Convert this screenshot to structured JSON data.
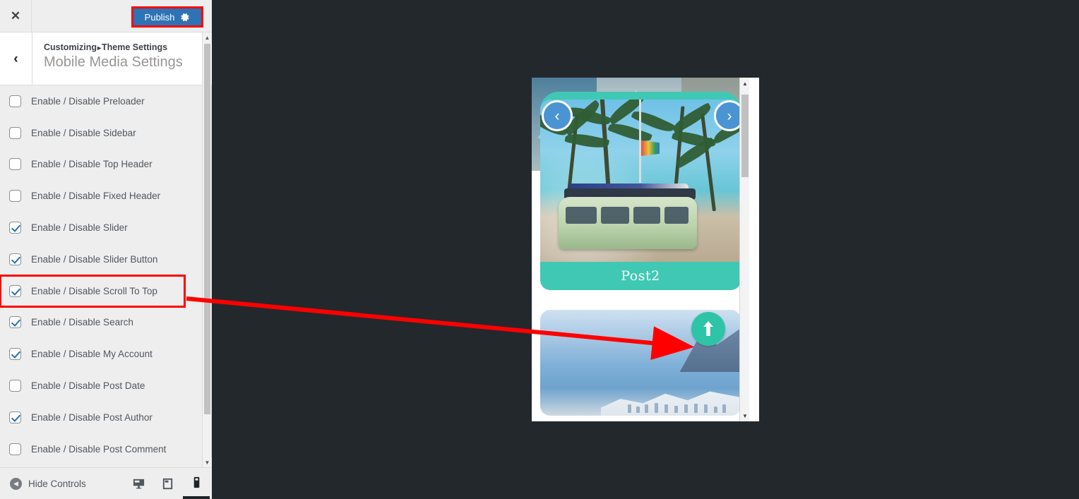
{
  "customizer": {
    "close_icon": "close-icon",
    "close_glyph": "✕",
    "publish_label": "Publish",
    "publish_gear_icon": "gear-icon",
    "back_glyph": "‹",
    "breadcrumb_root": "Customizing",
    "breadcrumb_separator": "▸",
    "breadcrumb_section": "Theme Settings",
    "panel_title": "Mobile Media Settings",
    "accent_blue": "#2e73b5",
    "highlight_red": "#ff0000",
    "controls": [
      {
        "label": "Enable / Disable Preloader",
        "checked": false
      },
      {
        "label": "Enable / Disable Sidebar",
        "checked": false
      },
      {
        "label": "Enable / Disable Top Header",
        "checked": false
      },
      {
        "label": "Enable / Disable Fixed Header",
        "checked": false
      },
      {
        "label": "Enable / Disable Slider",
        "checked": true
      },
      {
        "label": "Enable / Disable Slider Button",
        "checked": true
      },
      {
        "label": "Enable / Disable Scroll To Top",
        "checked": true,
        "highlighted": true
      },
      {
        "label": "Enable / Disable Search",
        "checked": true
      },
      {
        "label": "Enable / Disable My Account",
        "checked": true
      },
      {
        "label": "Enable / Disable Post Date",
        "checked": false
      },
      {
        "label": "Enable / Disable Post Author",
        "checked": true
      },
      {
        "label": "Enable / Disable Post Comment",
        "checked": false
      }
    ],
    "footer": {
      "hide_controls_label": "Hide Controls",
      "hide_controls_icon": "collapse-arrow-icon",
      "devices": [
        {
          "name": "desktop",
          "icon": "desktop-icon",
          "active": false
        },
        {
          "name": "tablet",
          "icon": "tablet-icon",
          "active": false
        },
        {
          "name": "mobile",
          "icon": "mobile-icon",
          "active": true
        }
      ]
    }
  },
  "preview": {
    "device": "mobile",
    "slider": {
      "caption": "Post2",
      "prev_icon": "chevron-left-icon",
      "prev_glyph": "‹",
      "next_icon": "chevron-right-icon",
      "next_glyph": "›"
    },
    "scroll_to_top": {
      "icon": "arrow-up-icon",
      "color": "#2ec4a8"
    },
    "teal_accent": "#3fc9b4"
  },
  "annotation": {
    "color": "#ff0000",
    "type": "arrow",
    "points_from": "Enable / Disable Scroll To Top",
    "points_to": "scroll-to-top-button"
  }
}
